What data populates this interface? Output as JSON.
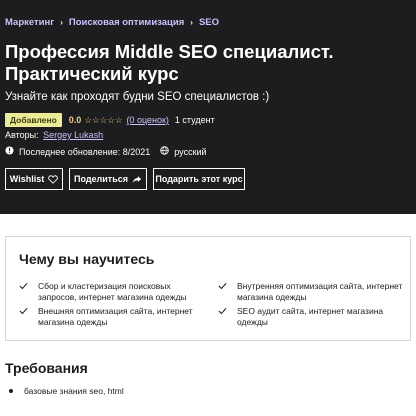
{
  "breadcrumb": [
    "Маркетинг",
    "Поисковая оптимизация",
    "SEO"
  ],
  "course": {
    "title": "Профессия Middle SEO специалист. Практический курс",
    "subtitle": "Узнайте как проходят будни SEO специалистов :)",
    "badge": "Добавлено",
    "rating": "0.0",
    "stars_filled": 0,
    "stars_total": 5,
    "ratings_count": "(0 оценок)",
    "students": "1 студент",
    "authors_label": "Авторы:",
    "author": "Sergey Lukash",
    "last_updated": "Последнее обновление: 8/2021",
    "language": "русский"
  },
  "buttons": {
    "wishlist": "Wishlist",
    "share": "Поделиться",
    "gift": "Подарить этот курс"
  },
  "learn": {
    "title": "Чему вы научитесь",
    "items": [
      "Сбор и кластеризация поисковых запросов, интернет магазина одежды",
      "Внутренняя оптимизация сайта, интернет магазина одежды",
      "Внешняя оптимизация сайта, интернет магазина одежды",
      "SEO аудит сайта, интернет магазина одежды"
    ]
  },
  "requirements": {
    "title": "Требования",
    "items": [
      "базовые знания seo, html"
    ]
  },
  "colors": {
    "hero_bg": "#1c1d1f",
    "link": "#cec0fc",
    "star": "#f3ca8c",
    "badge_bg": "#eceb98"
  },
  "icons": {
    "separator": "chevron-right-icon",
    "star": "star-outline-icon",
    "update": "alert-circle-icon",
    "language": "globe-icon",
    "wishlist": "heart-icon",
    "share": "share-arrow-icon",
    "check": "check-icon",
    "bullet": "bullet-icon"
  }
}
